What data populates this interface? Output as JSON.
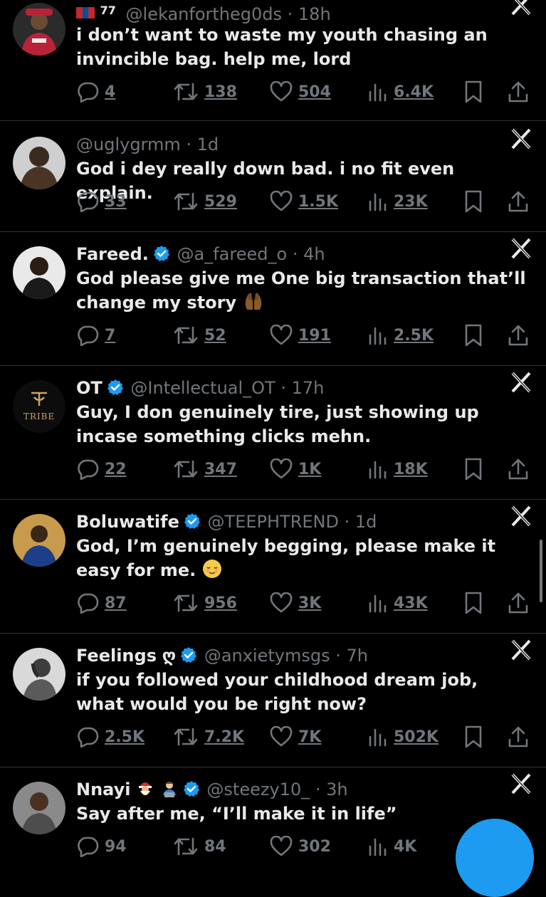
{
  "tweets": [
    {
      "name": "",
      "badge": "77",
      "handle": "@lekanfortheg0ds",
      "time": "· 18h",
      "text": "i don’t want to waste my youth chasing an invincible bag. help me, lord",
      "replies": "4",
      "retweets": "138",
      "likes": "504",
      "views": "6.4K",
      "avatar_color": "#b8233a"
    },
    {
      "name": "",
      "handle": "@uglygrmm",
      "time": "· 1d",
      "text": "God i dey really down bad. i no fit even explain.",
      "replies": "33",
      "retweets": "529",
      "likes": "1.5K",
      "views": "23K",
      "avatar_color": "#5a4632"
    },
    {
      "name": "Fareed.",
      "handle": "@a_fareed_o",
      "time": "· 4h",
      "text": "God please give me One big transaction that’ll change my story",
      "replies": "7",
      "retweets": "52",
      "likes": "191",
      "views": "2.5K",
      "avatar_color": "#e9e9e9"
    },
    {
      "name": "OT",
      "handle": "@Intellectual_OT",
      "time": "· 17h",
      "text": "Guy, I don genuinely tire, just showing up incase something clicks mehn.",
      "replies": "22",
      "retweets": "347",
      "likes": "1K",
      "views": "18K",
      "avatar_color": "#0c0c0c",
      "avatar_text": "TRIBE"
    },
    {
      "name": "Boluwatife",
      "handle": "@TEEPHTREND",
      "time": "· 1d",
      "text": "God, I’m genuinely begging, please make it easy for me.",
      "replies": "87",
      "retweets": "956",
      "likes": "3K",
      "views": "43K",
      "avatar_color": "#c79a4c"
    },
    {
      "name": "Feelings",
      "name_symbol": "ღ",
      "handle": "@anxietymsgs",
      "time": "· 7h",
      "text": "if you followed your childhood dream job, what would you be right now?",
      "replies": "2.5K",
      "retweets": "7.2K",
      "likes": "7K",
      "views": "502K",
      "avatar_color": "#d9d9d9"
    },
    {
      "name": "Nnayi",
      "handle": "@steezy10_",
      "time": "· 3h",
      "text": "Say after me, “I’ll make it in life”",
      "replies": "94",
      "retweets": "84",
      "likes": "302",
      "views": "4K",
      "avatar_color": "#6e6e6e"
    }
  ],
  "colors": {
    "background": "#000000",
    "text": "#e7e9ea",
    "muted": "#71767b",
    "verified": "#1d9bf0",
    "divider": "#2f3336"
  },
  "icons": [
    "reply-icon",
    "retweet-icon",
    "like-icon",
    "views-icon",
    "bookmark-icon",
    "share-icon",
    "close-x-icon",
    "verified-badge-icon"
  ]
}
